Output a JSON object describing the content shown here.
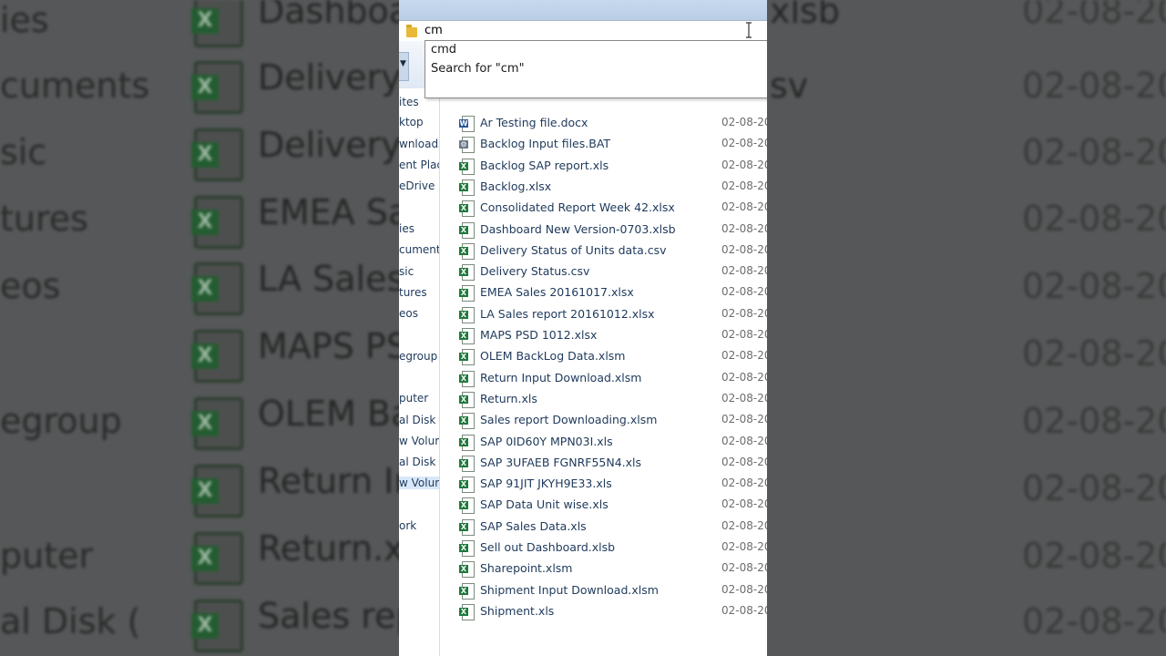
{
  "background": {
    "sidebar_items": [
      "ies",
      "cuments",
      "sic",
      "tures",
      "eos",
      "egroup",
      "puter",
      "al Disk ("
    ],
    "file_names": [
      "Dashboa",
      "Delivery",
      "Delivery",
      "EMEA Sa",
      "LA Sales",
      "MAPS PS",
      "OLEM Ba",
      "Return In",
      "Return.xls",
      "Sales rep"
    ],
    "right_types": [
      "xlsb",
      "sv"
    ],
    "dates": [
      "02-08-20",
      "02-08-20",
      "02-08-20",
      "02-08-20",
      "02-08-20",
      "02-08-20",
      "02-08-20",
      "02-08-20",
      "02-08-20",
      "02-08-20"
    ]
  },
  "address_bar": {
    "text": "cm"
  },
  "autocomplete": {
    "items": [
      "cmd",
      "Search for \"cm\""
    ]
  },
  "nav_pane": {
    "items": [
      "ites",
      "ktop",
      "wnloads",
      "ent Plac",
      "eDrive",
      "ies",
      "cuments",
      "sic",
      "tures",
      "eos",
      "egroup",
      "puter",
      "al Disk (",
      "w Volum",
      "al Disk (",
      "w Volum",
      "ork"
    ]
  },
  "files": [
    {
      "name": "Ar Testing file.docx",
      "type": "word",
      "date": "02-08-20"
    },
    {
      "name": "Backlog Input files.BAT",
      "type": "bat",
      "date": "02-08-20"
    },
    {
      "name": "Backlog SAP report.xls",
      "type": "excel",
      "date": "02-08-20"
    },
    {
      "name": "Backlog.xlsx",
      "type": "excel",
      "date": "02-08-20"
    },
    {
      "name": "Consolidated Report Week 42.xlsx",
      "type": "excel",
      "date": "02-08-20"
    },
    {
      "name": "Dashboard New Version-0703.xlsb",
      "type": "excel",
      "date": "02-08-20"
    },
    {
      "name": "Delivery Status of Units data.csv",
      "type": "excel",
      "date": "02-08-20"
    },
    {
      "name": "Delivery Status.csv",
      "type": "excel",
      "date": "02-08-20"
    },
    {
      "name": "EMEA Sales 20161017.xlsx",
      "type": "excel",
      "date": "02-08-20"
    },
    {
      "name": "LA Sales report 20161012.xlsx",
      "type": "excel",
      "date": "02-08-20"
    },
    {
      "name": "MAPS PSD 1012.xlsx",
      "type": "excel",
      "date": "02-08-20"
    },
    {
      "name": "OLEM BackLog Data.xlsm",
      "type": "excel",
      "date": "02-08-20"
    },
    {
      "name": "Return Input Download.xlsm",
      "type": "excel",
      "date": "02-08-20"
    },
    {
      "name": "Return.xls",
      "type": "excel",
      "date": "02-08-20"
    },
    {
      "name": "Sales report Downloading.xlsm",
      "type": "excel",
      "date": "02-08-20"
    },
    {
      "name": "SAP 0ID60Y MPN03I.xls",
      "type": "excel",
      "date": "02-08-20"
    },
    {
      "name": "SAP 3UFAEB FGNRF55N4.xls",
      "type": "excel",
      "date": "02-08-20"
    },
    {
      "name": "SAP 91JIT  JKYH9E33.xls",
      "type": "excel",
      "date": "02-08-20"
    },
    {
      "name": "SAP Data Unit wise.xls",
      "type": "excel",
      "date": "02-08-20"
    },
    {
      "name": "SAP Sales Data.xls",
      "type": "excel",
      "date": "02-08-20"
    },
    {
      "name": "Sell out Dashboard.xlsb",
      "type": "excel",
      "date": "02-08-20"
    },
    {
      "name": "Sharepoint.xlsm",
      "type": "excel",
      "date": "02-08-20"
    },
    {
      "name": "Shipment Input Download.xlsm",
      "type": "excel",
      "date": "02-08-20"
    },
    {
      "name": "Shipment.xls",
      "type": "excel",
      "date": "02-08-20"
    }
  ],
  "colors": {
    "excel": "#1f7a3c",
    "word": "#2b5797",
    "link_text": "#1e395b",
    "date_text": "#6d6d6d"
  }
}
